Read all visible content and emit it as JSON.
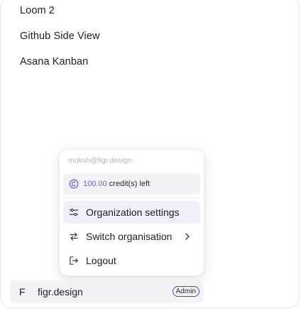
{
  "sidebar": {
    "items": [
      {
        "label": "Loom 2"
      },
      {
        "label": "Github Side View"
      },
      {
        "label": "Asana Kanban"
      }
    ]
  },
  "account_menu": {
    "email": "moksh@figr.design",
    "credits": {
      "amount": "100.00",
      "suffix": "credit(s) left",
      "icon": "coin-icon"
    },
    "items": [
      {
        "label": "Organization settings",
        "icon": "sliders-icon",
        "highlighted": true
      },
      {
        "label": "Switch organisation",
        "icon": "swap-icon",
        "has_submenu": true
      },
      {
        "label": "Logout",
        "icon": "logout-icon"
      }
    ]
  },
  "workspace": {
    "initial": "F",
    "name": "figr.design",
    "role_badge": "Admin"
  },
  "colors": {
    "accent": "#6a5fe0",
    "badge_border": "#4c3fd8",
    "highlight_bg": "#efeff9",
    "credits_bg": "#f3f3f5"
  }
}
